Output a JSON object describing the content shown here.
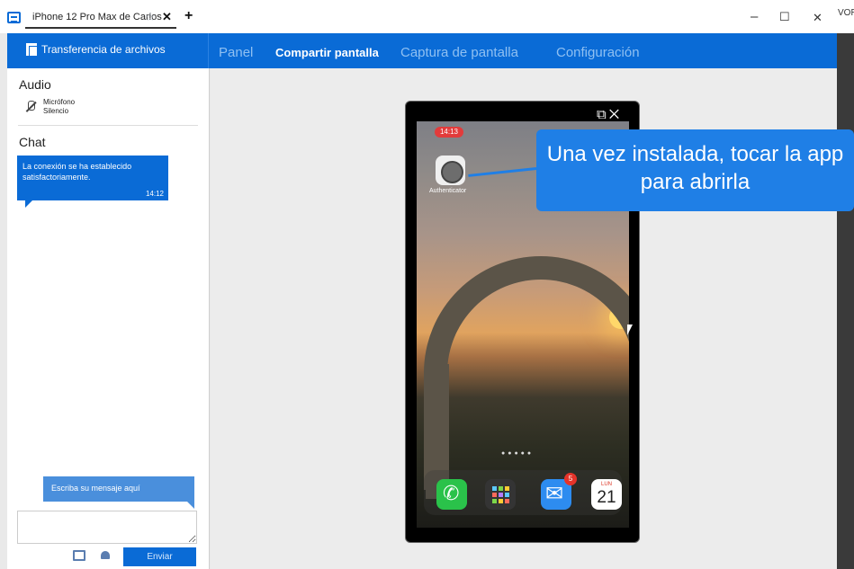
{
  "window": {
    "tab_title": "iPhone 12 Pro Max de Carlos",
    "tab_add": "+",
    "minimize": "–",
    "maximize": "☐",
    "close": "✕",
    "tab_star": "☆",
    "tab_close": "✕",
    "clipped_text": "VORI"
  },
  "nav": {
    "file_transfer": "Transferencia de archivos",
    "items": [
      "Panel",
      "Compartir pantalla",
      "Captura de pantalla",
      "Configuración"
    ],
    "active": "Compartir pantalla"
  },
  "audio": {
    "title": "Audio",
    "mic_name": "Micrófono",
    "mic_state": "Silencio"
  },
  "chat": {
    "title": "Chat",
    "message": "La conexión se ha establecido satisfactoriamente.",
    "time": "14:12",
    "placeholder_hint": "Escriba su mensaje aquí",
    "input_value": "",
    "send_label": "Enviar"
  },
  "phone": {
    "tools": "⧉✕",
    "clock": "14:13",
    "app_label": "Authenticator",
    "page_dots": "●●●●●",
    "mail_badge": "5",
    "cal_day": "LUN",
    "cal_num": "21"
  },
  "callout": {
    "text": "Una vez instalada, tocar la app para abrirla"
  },
  "colors": {
    "brand": "#0a6bd6",
    "callout": "#1f7fe6",
    "badge": "#e5332a"
  }
}
